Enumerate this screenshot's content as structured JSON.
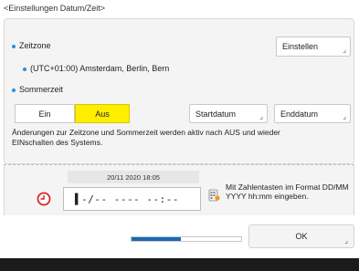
{
  "title": "<Einstellungen Datum/Zeit>",
  "timezone": {
    "label": "Zeitzone",
    "set_button": "Einstellen",
    "value": "(UTC+01:00) Amsterdam, Berlin, Bern"
  },
  "dst": {
    "label": "Sommerzeit",
    "on_label": "Ein",
    "off_label": "Aus",
    "selected": "Aus",
    "start_button": "Startdatum",
    "end_button": "Enddatum"
  },
  "note": "Änderungen zur Zeitzone und Sommerzeit werden aktiv nach AUS und wieder EINschalten des Systems.",
  "datetime": {
    "caption": "20/11 2020 18:05",
    "input_value": "▌-/-- ---- --:--",
    "hint": "Mit Zahlentasten im Format DD/MM YYYY hh:mm eingeben."
  },
  "progress": {
    "fraction": 0.45
  },
  "ok_label": "OK",
  "colors": {
    "accent": "#2b8fd6",
    "selected": "#ffee00",
    "progress": "#1d67b5"
  }
}
